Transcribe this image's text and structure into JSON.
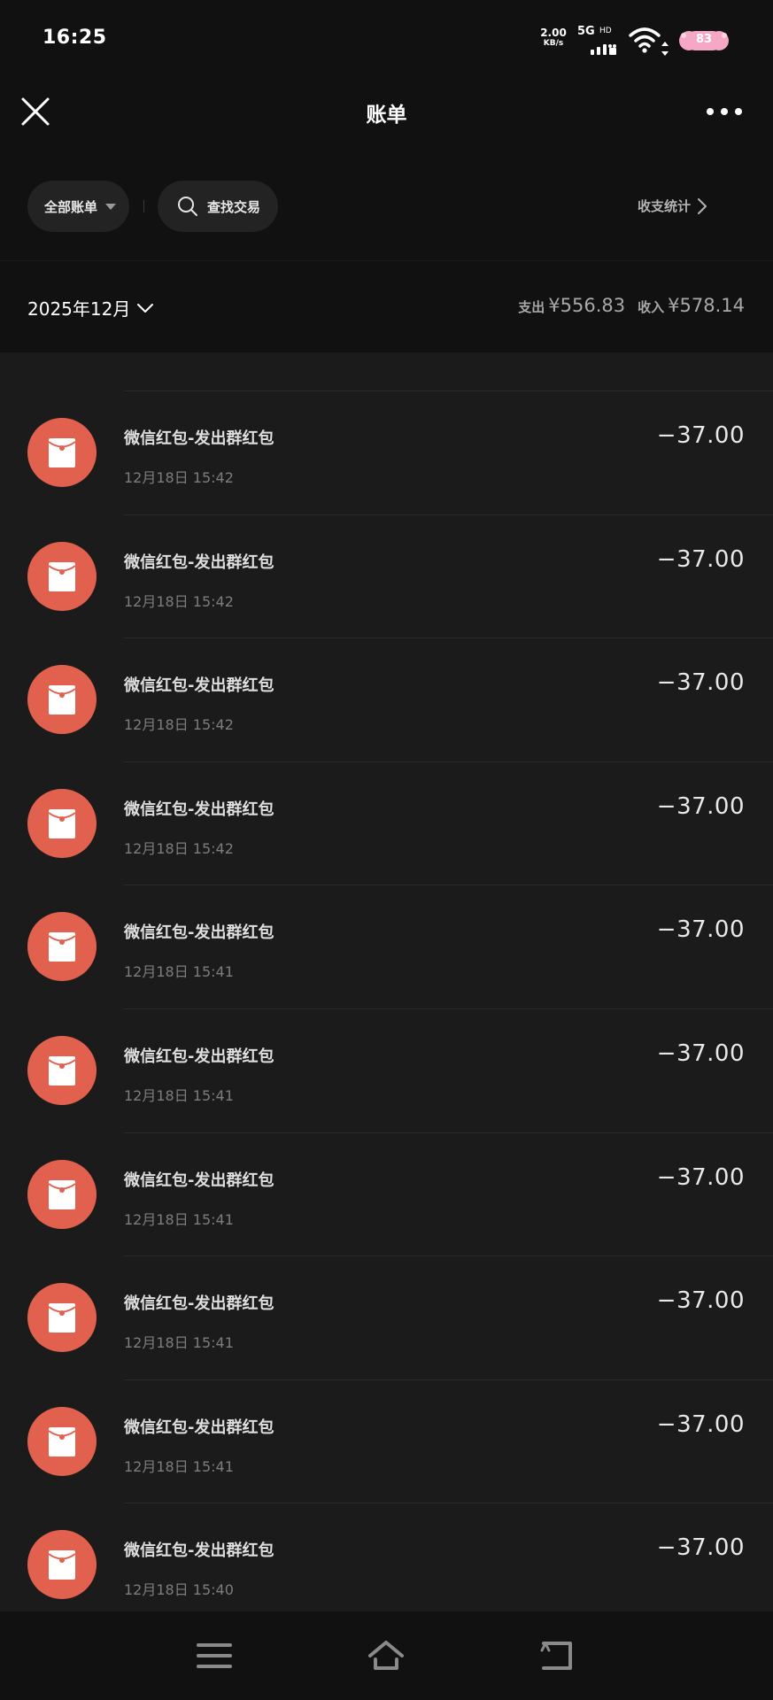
{
  "status_bar": {
    "time": "16:25",
    "net_speed_value": "2.00",
    "net_speed_unit": "KB/s",
    "network_type": "5G",
    "hd_label": "HD",
    "battery_level": "83"
  },
  "header": {
    "title": "账单"
  },
  "filters": {
    "all_bills_label": "全部账单",
    "search_label": "查找交易",
    "stats_label": "收支统计"
  },
  "month_summary": {
    "month": "2025年12月",
    "expense_label": "支出",
    "expense_amount": "¥556.83",
    "income_label": "收入",
    "income_amount": "¥578.14"
  },
  "transactions": [
    {
      "title": "",
      "time": "",
      "amount": ""
    },
    {
      "title": "微信红包-发出群红包",
      "time": "12月18日 15:42",
      "amount": "−37.00"
    },
    {
      "title": "微信红包-发出群红包",
      "time": "12月18日 15:42",
      "amount": "−37.00"
    },
    {
      "title": "微信红包-发出群红包",
      "time": "12月18日 15:42",
      "amount": "−37.00"
    },
    {
      "title": "微信红包-发出群红包",
      "time": "12月18日 15:42",
      "amount": "−37.00"
    },
    {
      "title": "微信红包-发出群红包",
      "time": "12月18日 15:41",
      "amount": "−37.00"
    },
    {
      "title": "微信红包-发出群红包",
      "time": "12月18日 15:41",
      "amount": "−37.00"
    },
    {
      "title": "微信红包-发出群红包",
      "time": "12月18日 15:41",
      "amount": "−37.00"
    },
    {
      "title": "微信红包-发出群红包",
      "time": "12月18日 15:41",
      "amount": "−37.00"
    },
    {
      "title": "微信红包-发出群红包",
      "time": "12月18日 15:41",
      "amount": "−37.00"
    },
    {
      "title": "微信红包-发出群红包",
      "time": "12月18日 15:40",
      "amount": "−37.00"
    }
  ],
  "colors": {
    "red_packet": "#E2614E",
    "background": "#1B1B1B",
    "header_background": "#111111"
  },
  "icons": {
    "close": "close-icon",
    "more": "more-icon",
    "search": "search-icon",
    "red_packet": "red-packet-icon",
    "nav_menu": "menu-icon",
    "nav_home": "home-icon",
    "nav_back": "back-icon"
  }
}
